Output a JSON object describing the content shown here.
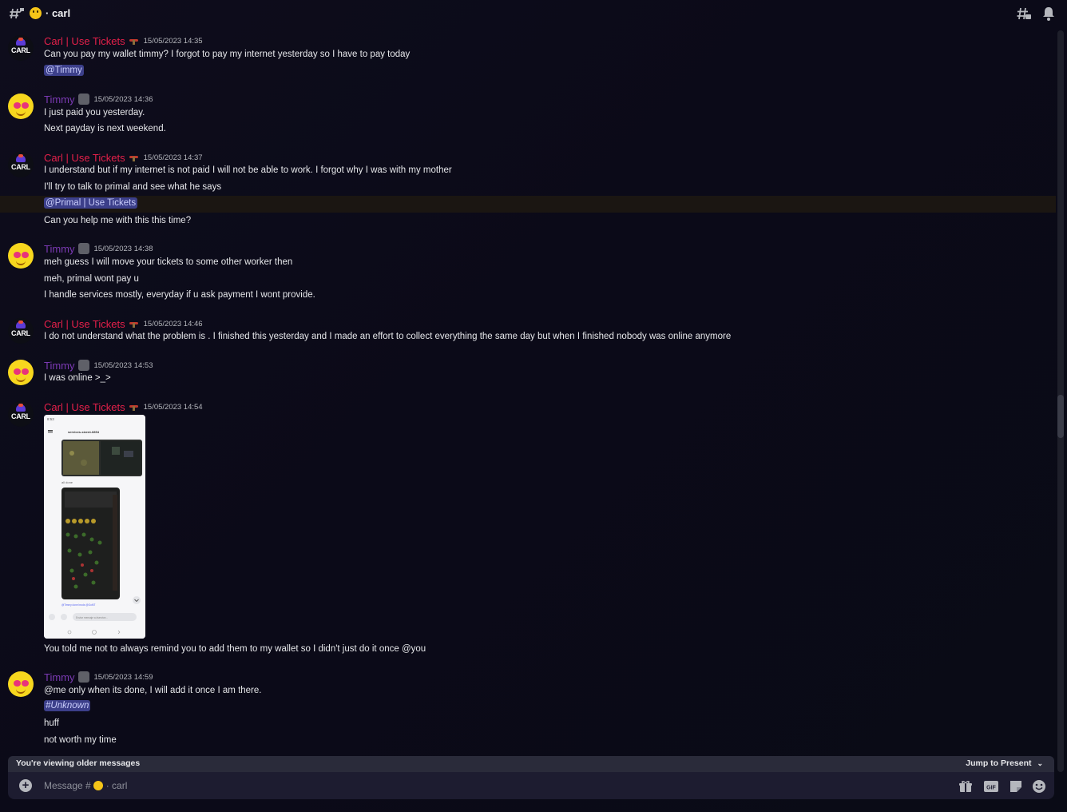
{
  "channel": {
    "name": "carl",
    "emoji": "grinning-face-emoji"
  },
  "icons": {
    "threads": "threads-icon",
    "notifications": "bell-icon",
    "add": "plus-circle-icon",
    "gift": "gift-icon",
    "gif": "GIF",
    "sticker": "sticker-icon",
    "emoji": "emoji-icon"
  },
  "messages": [
    {
      "author": "Carl | Use Tickets",
      "time": "15/05/2023 14:35",
      "lines": [
        "Can you pay my wallet timmy? I forgot to pay my internet yesterday so I have to pay today"
      ],
      "mention": "@Timmy"
    },
    {
      "author": "Timmy",
      "time": "15/05/2023 14:36",
      "lines": [
        "I just paid you yesterday.",
        "Next payday is next weekend."
      ]
    },
    {
      "author": "Carl | Use Tickets",
      "time": "15/05/2023 14:37",
      "lines": [
        "I understand but if my internet is not paid I will not be able to work. I forgot why I was with my mother",
        "I'll try to talk to primal and see what he says",
        "Can you help me with this this time?"
      ],
      "mention": "@Primal | Use Tickets"
    },
    {
      "author": "Timmy",
      "time": "15/05/2023 14:38",
      "lines": [
        "meh guess I will move your tickets to some other worker then",
        "meh, primal wont pay u",
        "I handle services mostly, everyday if u ask payment I wont provide."
      ]
    },
    {
      "author": "Carl | Use Tickets",
      "time": "15/05/2023 14:46",
      "lines": [
        "I do not understand what the problem is . I finished this yesterday and I made an effort to collect everything the same day but when I finished nobody was online anymore"
      ]
    },
    {
      "author": "Timmy",
      "time": "15/05/2023 14:53",
      "lines": [
        "I was online >_>"
      ]
    },
    {
      "author": "Carl | Use Tickets",
      "time": "15/05/2023 14:54",
      "lines": [
        "You told me not to always remind you to add them to my wallet so I didn't just do it once @you"
      ],
      "attachment": {
        "status_time": "8:53",
        "channel": "services-sizent-6854",
        "caption": "all done",
        "mention_line": "@Timmy done brods @GoMT",
        "input_placeholder": "Enviar mensaje a #service..."
      }
    },
    {
      "author": "Timmy",
      "time": "15/05/2023 14:59",
      "lines": [
        "@me only when its done, I will add it once I am there.",
        "huff",
        "not worth my time"
      ],
      "channel_mention": "#Unknown"
    }
  ],
  "banner": {
    "left": "You're viewing older messages",
    "right": "Jump to Present"
  },
  "composer": {
    "placeholder_prefix": "Message #",
    "placeholder_channel": "· carl"
  }
}
